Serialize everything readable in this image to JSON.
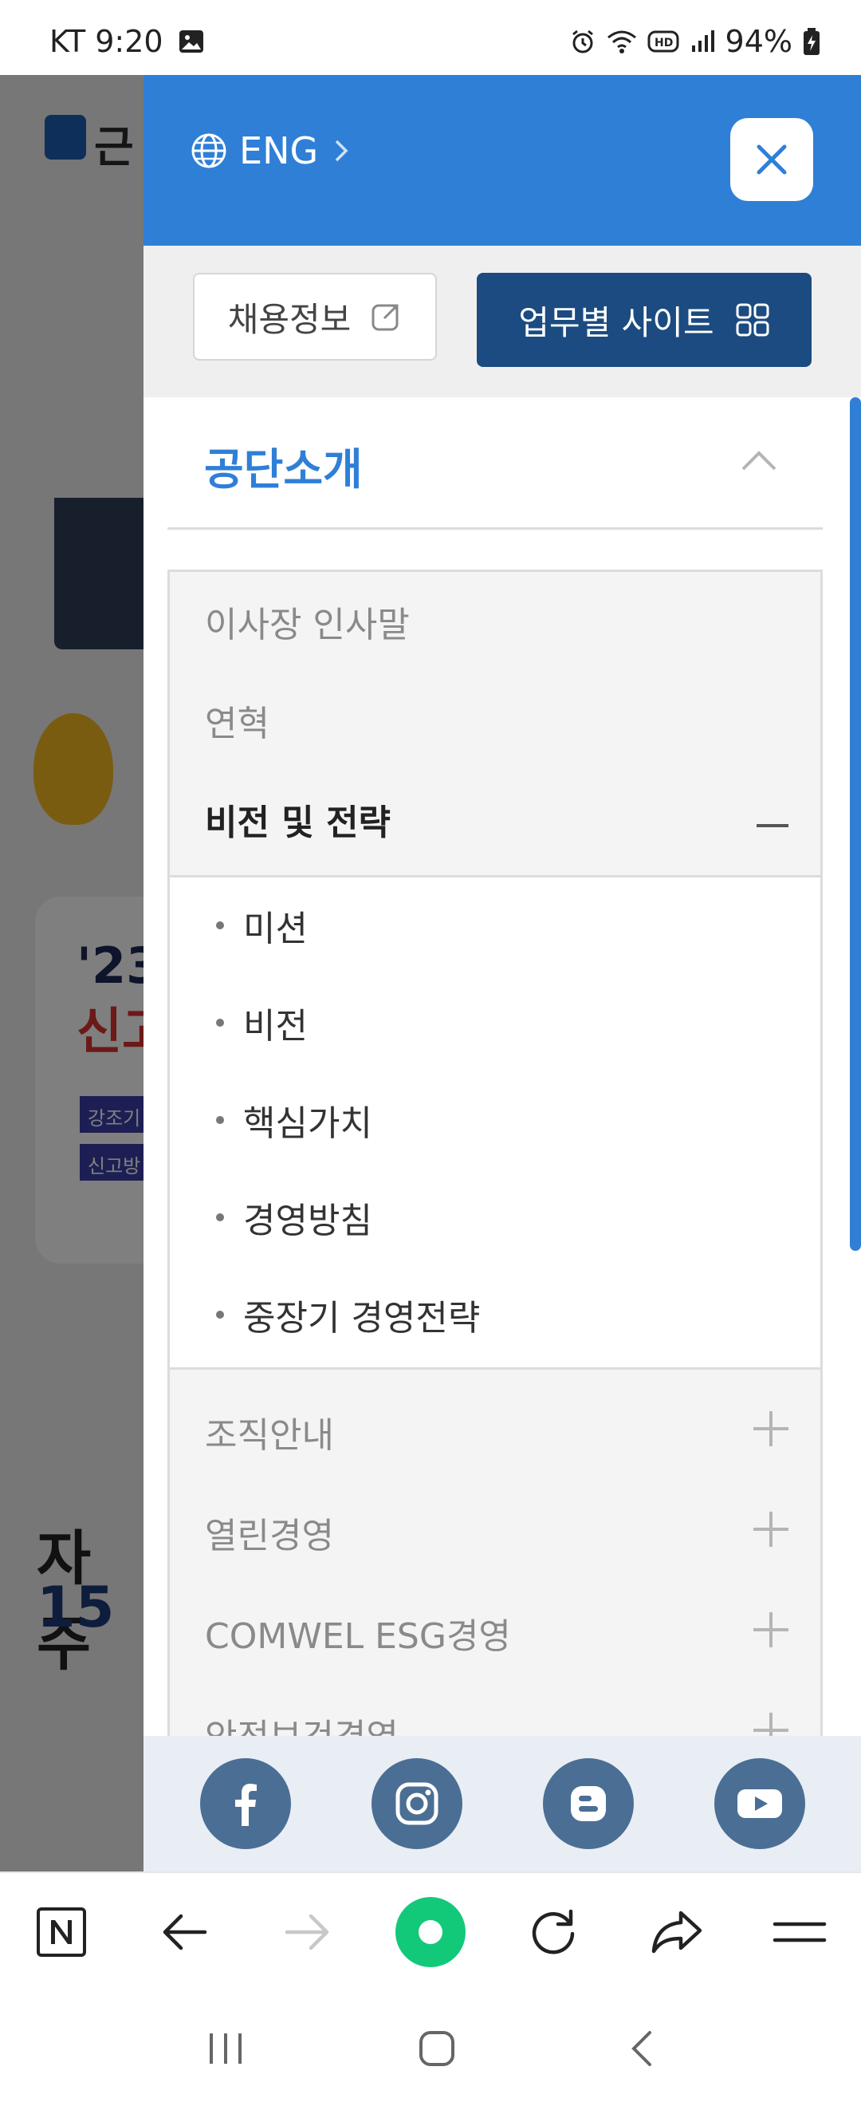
{
  "status_bar": {
    "carrier_time": "KT 9:20",
    "battery": "94%"
  },
  "background_page": {
    "logo_text": "근",
    "card_year": "'23",
    "card_sub": "신고",
    "card_tag1": "강조기",
    "card_tag2": "신고방",
    "faq_text": "자주",
    "phone_text": "15"
  },
  "drawer": {
    "language_label": "ENG",
    "recruit_label": "채용정보",
    "sites_label": "업무별 사이트",
    "section_title": "공단소개",
    "sub_items": [
      {
        "label": "이사장 인사말"
      },
      {
        "label": "연혁"
      },
      {
        "label": "비전 및 전략"
      }
    ],
    "detail_items": [
      {
        "label": "미션"
      },
      {
        "label": "비전"
      },
      {
        "label": "핵심가치"
      },
      {
        "label": "경영방침"
      },
      {
        "label": "중장기 경영전략"
      }
    ],
    "more_items": [
      {
        "label": "조직안내"
      },
      {
        "label": "열린경영"
      },
      {
        "label": "COMWEL ESG경영"
      },
      {
        "label": "안전보건경영"
      }
    ]
  },
  "colors": {
    "primary": "#2f7fd7",
    "dark_button": "#1b4b80",
    "social": "#4b6e94"
  },
  "icons": [
    "globe-icon",
    "chevron-right-icon",
    "close-icon",
    "external-link-icon",
    "grid-icon",
    "chevron-up-icon",
    "minus-icon",
    "plus-icon",
    "facebook-icon",
    "instagram-icon",
    "blogger-icon",
    "youtube-icon",
    "naver-icon",
    "back-icon",
    "forward-icon",
    "home-dot-icon",
    "refresh-icon",
    "share-icon",
    "menu-icon"
  ]
}
